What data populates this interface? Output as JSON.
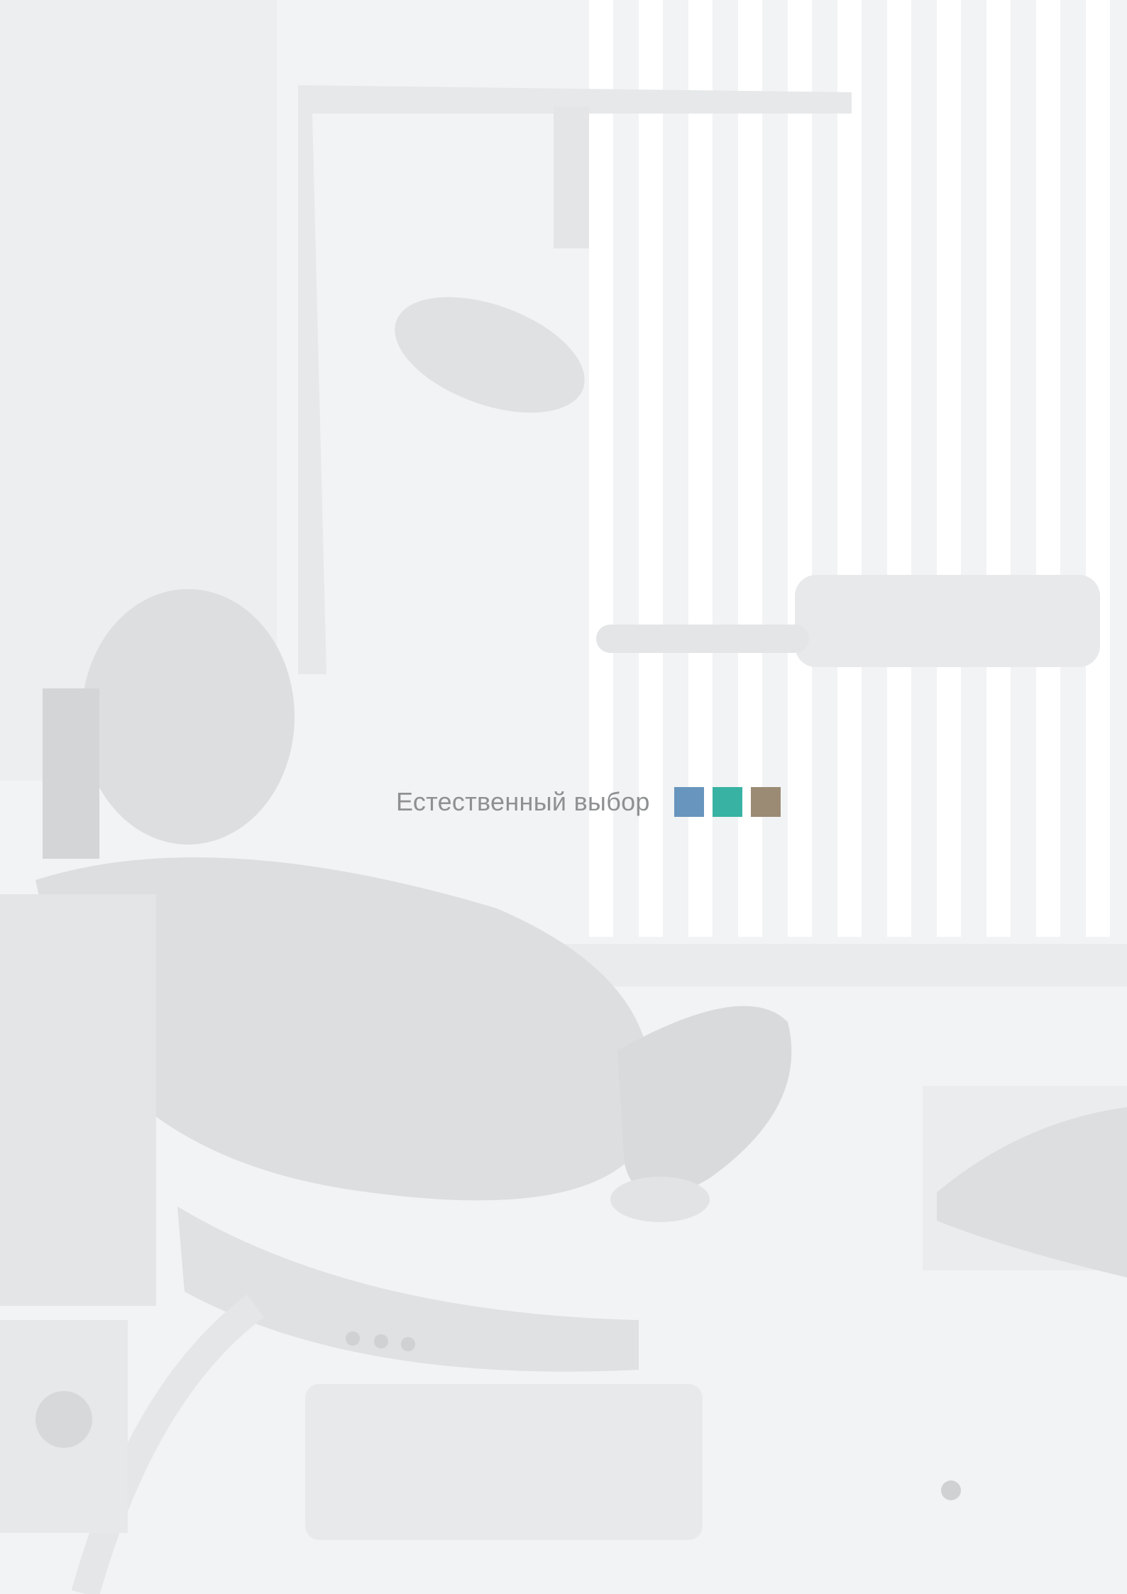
{
  "cover": {
    "title": "Естественный выбор",
    "swatches": [
      {
        "name": "blue",
        "color": "#6895bd"
      },
      {
        "name": "teal",
        "color": "#38b3a3"
      },
      {
        "name": "taupe",
        "color": "#9b8b74"
      }
    ]
  },
  "background": {
    "subject": "dental-office-photo",
    "tones": {
      "base": "#f3f4f5",
      "wall": "#eceeef",
      "chair": "#dcdedf",
      "shadow": "#cfd1d3"
    }
  }
}
